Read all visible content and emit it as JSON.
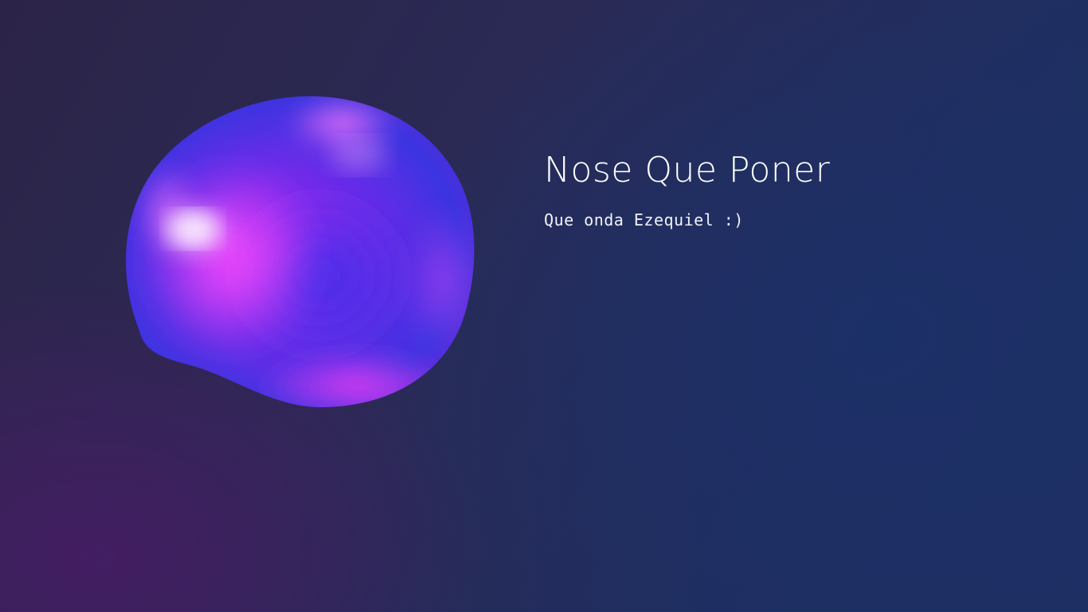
{
  "hero": {
    "title": "Nose Que Poner",
    "subtitle": "Que onda Ezequiel :)"
  },
  "colors": {
    "background_left": "#2c2448",
    "background_right": "#1d2f62",
    "blob_magenta": "#e83cff",
    "blob_blue": "#3a3ae8",
    "text": "#ffffff"
  },
  "decoration": {
    "blob": "iridescent-bubble-image"
  }
}
